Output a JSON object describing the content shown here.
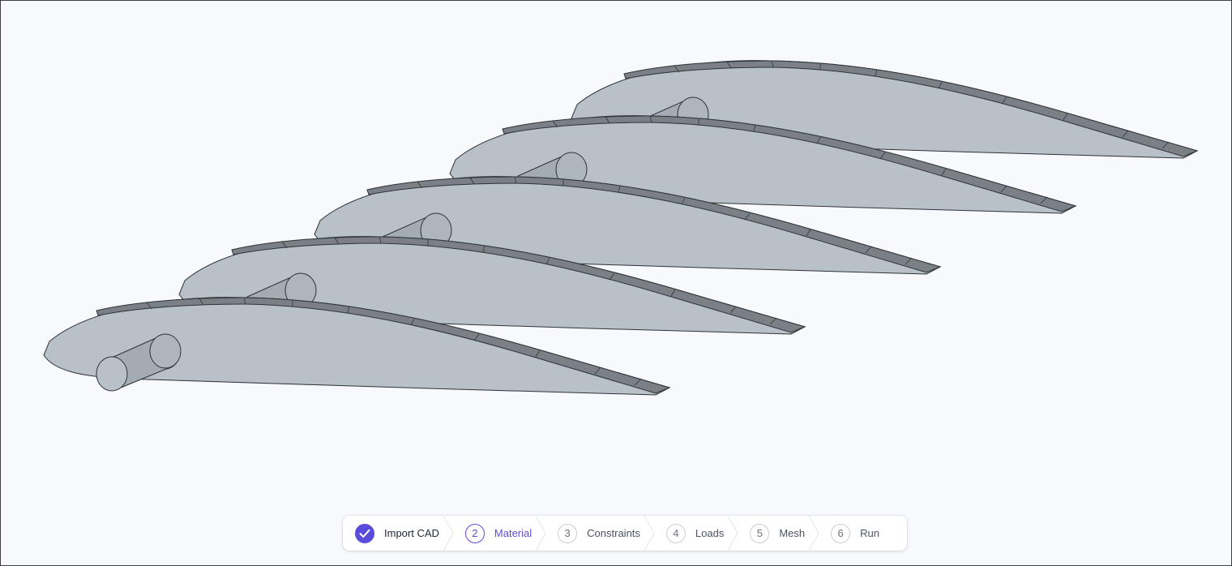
{
  "workflow": {
    "steps": [
      {
        "number": "",
        "label": "Import CAD",
        "state": "done",
        "icon": "check-icon"
      },
      {
        "number": "2",
        "label": "Material",
        "state": "active"
      },
      {
        "number": "3",
        "label": "Constraints",
        "state": "pending"
      },
      {
        "number": "4",
        "label": "Loads",
        "state": "pending"
      },
      {
        "number": "5",
        "label": "Mesh",
        "state": "pending"
      },
      {
        "number": "6",
        "label": "Run",
        "state": "pending"
      }
    ]
  },
  "theme": {
    "accent": "#5b4bdb",
    "surface_fill": "#b8c0c8",
    "edge_band": "#7b8087",
    "background": "#f7f9fc"
  },
  "model": {
    "object": "wing ribs with spar",
    "rib_count": 5
  }
}
